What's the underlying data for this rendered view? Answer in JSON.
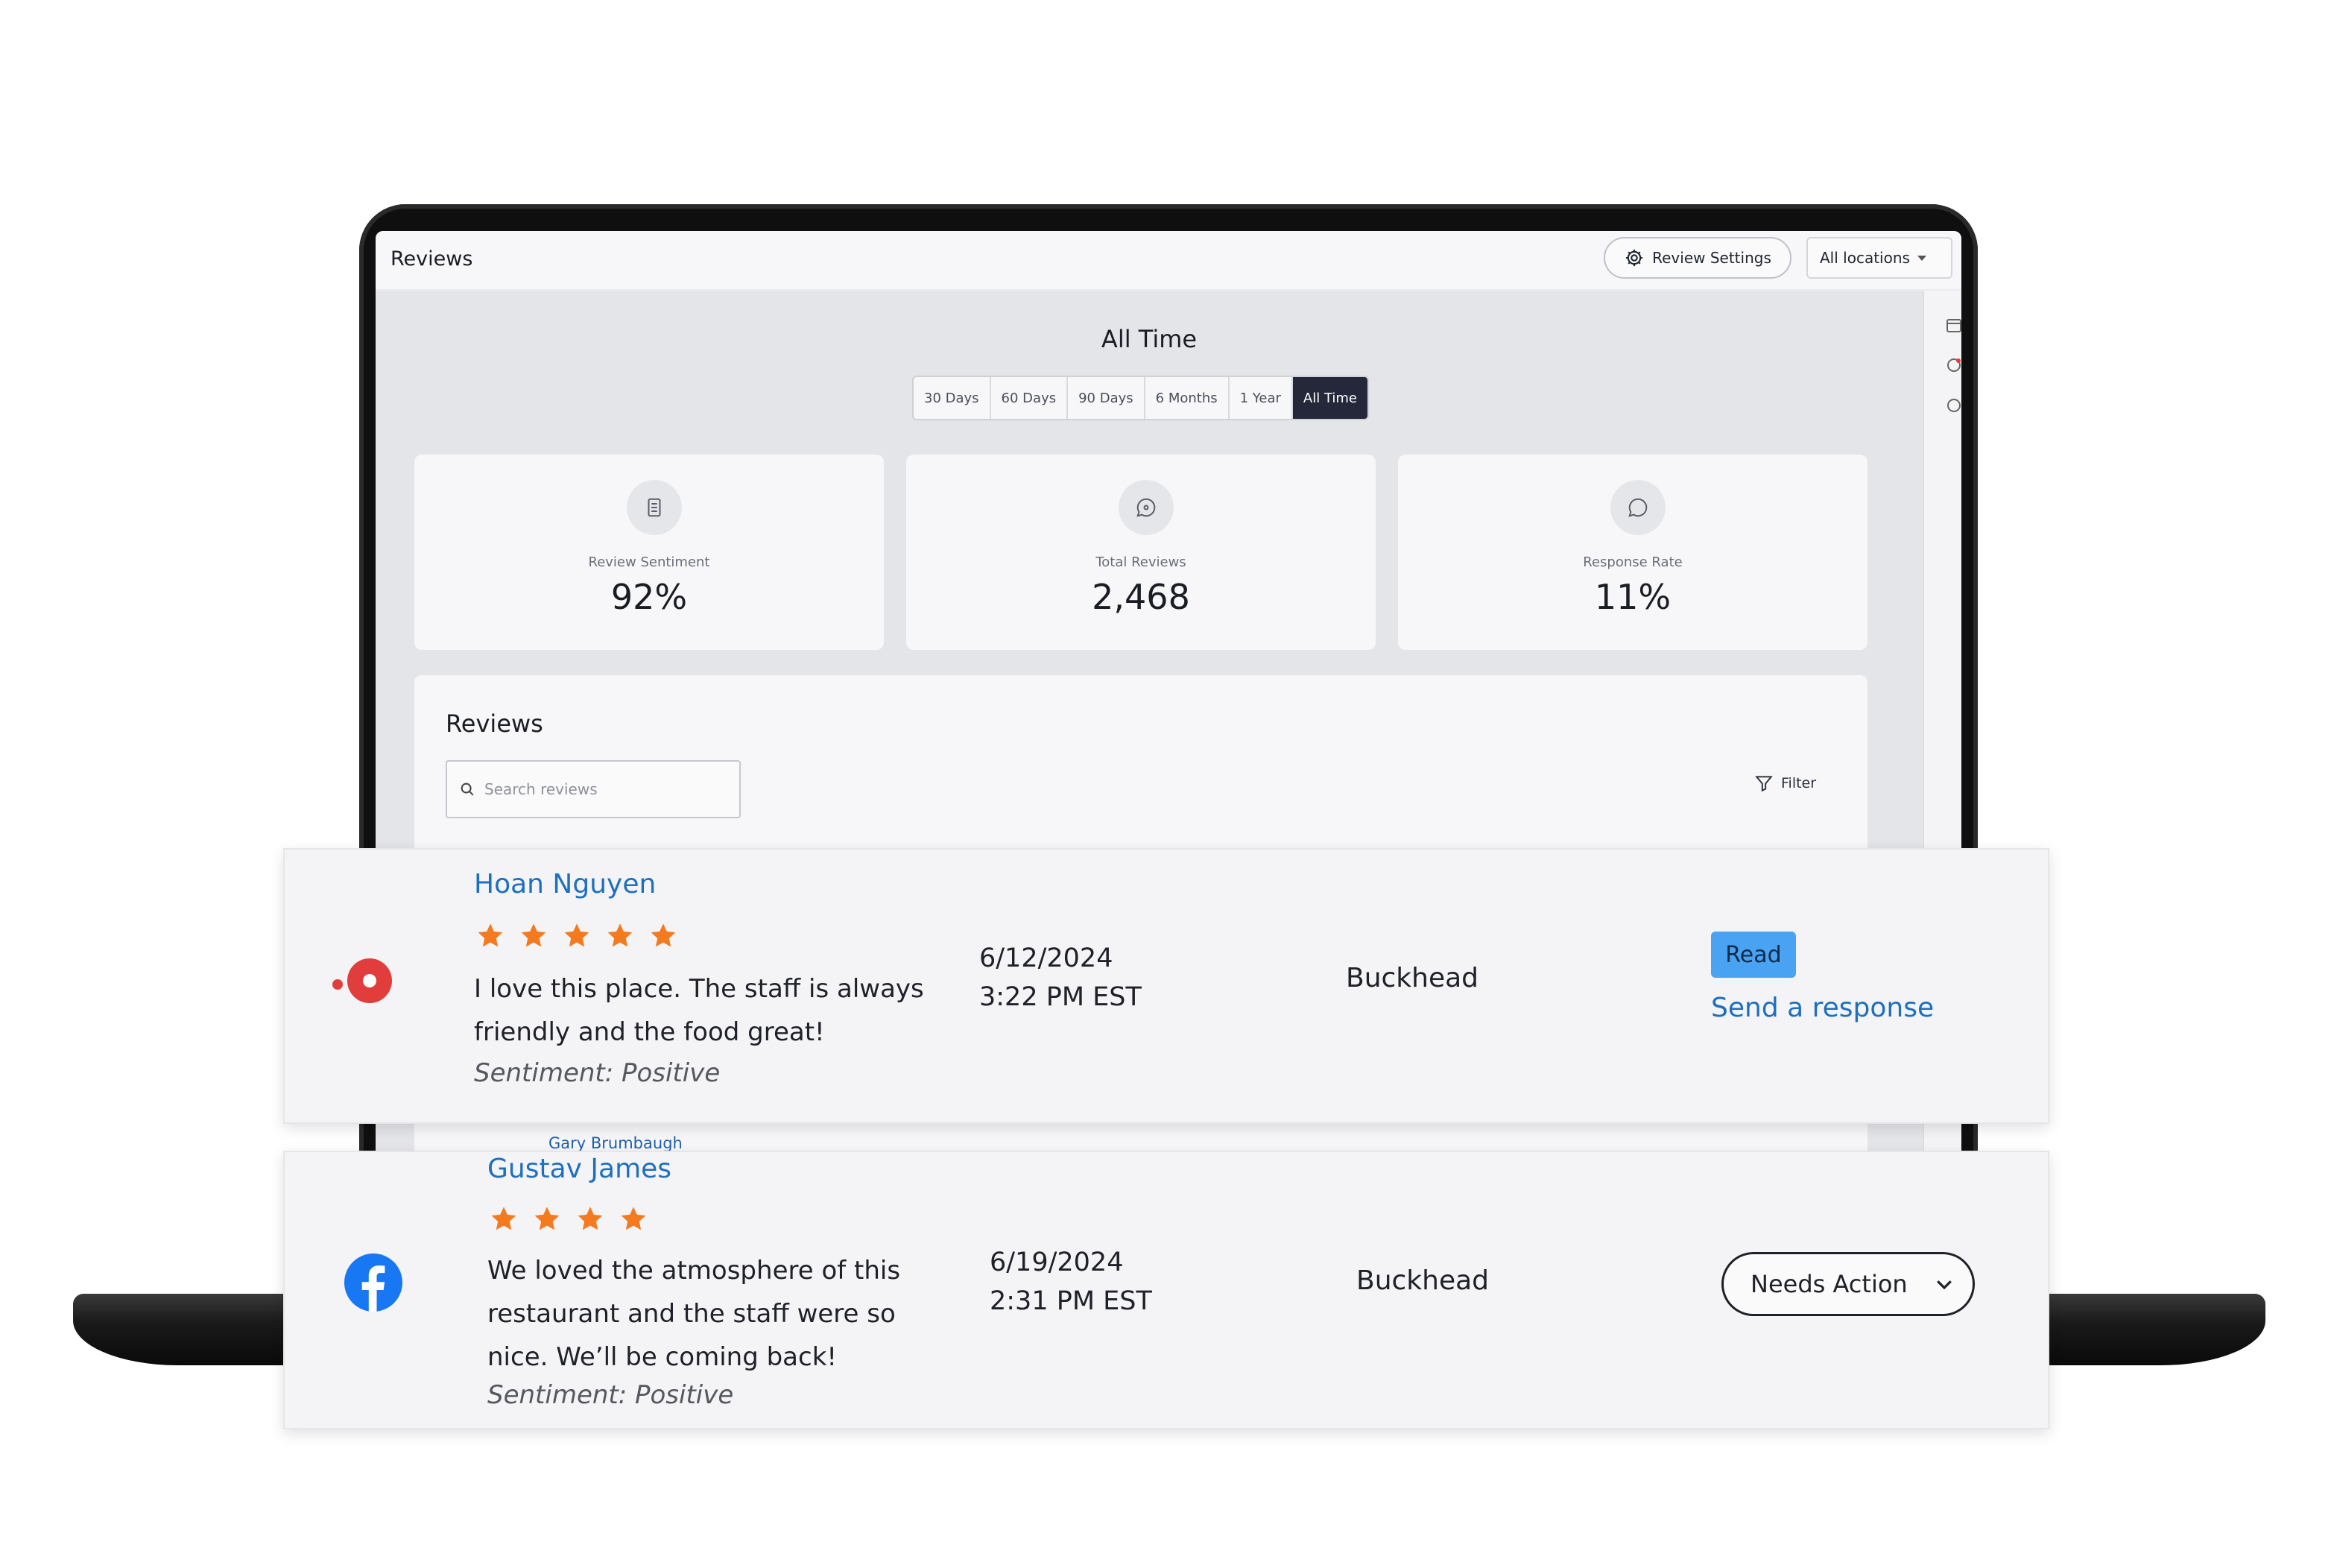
{
  "app": {
    "title": "Reviews",
    "settings_label": "Review Settings",
    "location_selected": "All locations"
  },
  "period": {
    "title": "All Time",
    "options": [
      "30 Days",
      "60 Days",
      "90 Days",
      "6 Months",
      "1 Year",
      "All Time"
    ],
    "active": "All Time"
  },
  "metrics": [
    {
      "label": "Review Sentiment",
      "value": "92%",
      "icon": "document-icon"
    },
    {
      "label": "Total Reviews",
      "value": "2,468",
      "icon": "chat-bubble-icon"
    },
    {
      "label": "Response Rate",
      "value": "11%",
      "icon": "speech-bubble-icon"
    }
  ],
  "reviews_section": {
    "heading": "Reviews",
    "search_placeholder": "Search reviews",
    "filter_label": "Filter",
    "peek_reviewer": "Gary Brumbaugh"
  },
  "reviews": [
    {
      "source": "yelp",
      "reviewer": "Hoan Nguyen",
      "rating": 5,
      "text": "I love this place. The staff is always friendly and the food great!",
      "sentiment": "Sentiment: Positive",
      "date": "6/12/2024",
      "time": "3:22 PM EST",
      "location": "Buckhead",
      "status": "Read",
      "action_link": "Send a response"
    },
    {
      "source": "facebook",
      "reviewer": "Gustav James",
      "rating": 4,
      "text": "We loved the atmosphere of this restaurant and the staff were so nice. We’ll be coming back!",
      "sentiment": "Sentiment: Positive",
      "date": "6/19/2024",
      "time": "2:31 PM EST",
      "location": "Buckhead",
      "status": "Needs Action"
    }
  ],
  "colors": {
    "accent_blue": "#1d6fc0",
    "star_orange": "#f47a20",
    "read_badge": "#4aa3f2",
    "active_segment": "#24283a",
    "yelp_red": "#e23d3d",
    "facebook_blue": "#1877f2"
  }
}
